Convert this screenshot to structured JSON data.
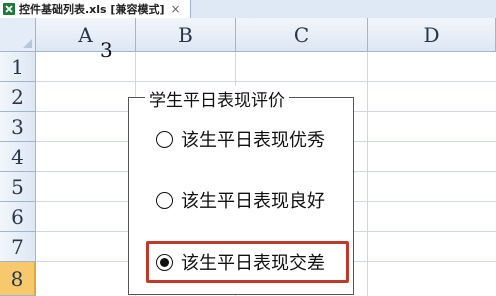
{
  "tab": {
    "title": "控件基础列表.xls  [兼容模式]",
    "close_glyph": "×",
    "icon": "excel-icon"
  },
  "columns": [
    "A",
    "B",
    "C",
    "D"
  ],
  "rows": [
    "1",
    "2",
    "3",
    "4",
    "5",
    "6",
    "7",
    "8"
  ],
  "active_row": "8",
  "cells": {
    "a1": "3"
  },
  "group_box": {
    "title": "学生平日表现评价",
    "options": [
      {
        "label": "该生平日表现优秀",
        "selected": false
      },
      {
        "label": "该生平日表现良好",
        "selected": false
      },
      {
        "label": "该生平日表现交差",
        "selected": true
      }
    ]
  },
  "colors": {
    "highlight": "#c0392b",
    "active_row_header": "#f8c96c"
  }
}
